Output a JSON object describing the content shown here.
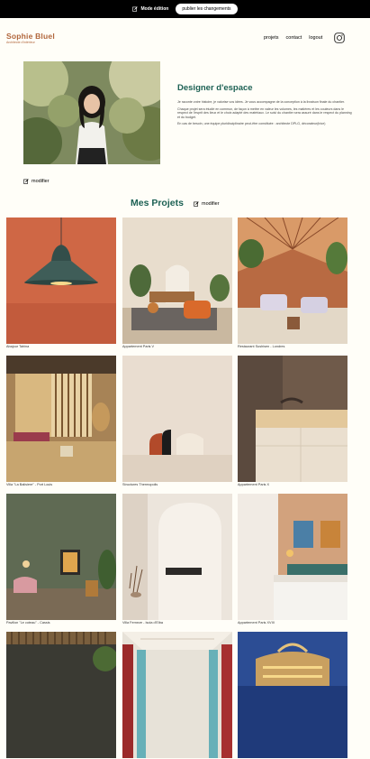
{
  "edit_bar": {
    "mode_label": "Mode édition",
    "publish_label": "publier les changements"
  },
  "header": {
    "logo_name": "Sophie Bluel",
    "logo_subtitle": "Architecte d'intérieur",
    "nav": [
      "projets",
      "contact",
      "logout"
    ],
    "instagram_icon": "instagram-icon"
  },
  "introduction": {
    "title": "Designer d'espace",
    "paragraphs": [
      "Je raconte votre histoire, je valorise vos idées. Je vous accompagne de la conception à la livraison finale du chantier.",
      "Chaque projet sera étudié en commun, de façon à mettre en valeur les volumes, les matières et les couleurs dans le respect de l'esprit des lieux et le choix adapté des matériaux. Le suivi du chantier sera assuré dans le respect du planning et du budget.",
      "En cas de besoin, une équipe pluridisciplinaire peut-être constituée : architecte DPLG, décorateur(trice)"
    ],
    "edit_label": "modifier"
  },
  "portfolio": {
    "title": "Mes Projets",
    "edit_label": "modifier",
    "projects": [
      "Abajour Tahina",
      "Appartement Paris V",
      "Restaurant Sushisen - Londres",
      "Villa \"La Balisiere\" - Port Louis",
      "Structures Thermopolis",
      "Appartement Paris X",
      "Pavillon \"Le coteau\" - Cassis",
      "Villa Ferneze - Isola d'Elba",
      "Appartement Paris XVIII",
      "",
      "",
      ""
    ]
  },
  "colors": {
    "brand": "#b1663c",
    "accent": "#1d6154",
    "edit_bar": "#000000",
    "background": "#fffef8"
  }
}
